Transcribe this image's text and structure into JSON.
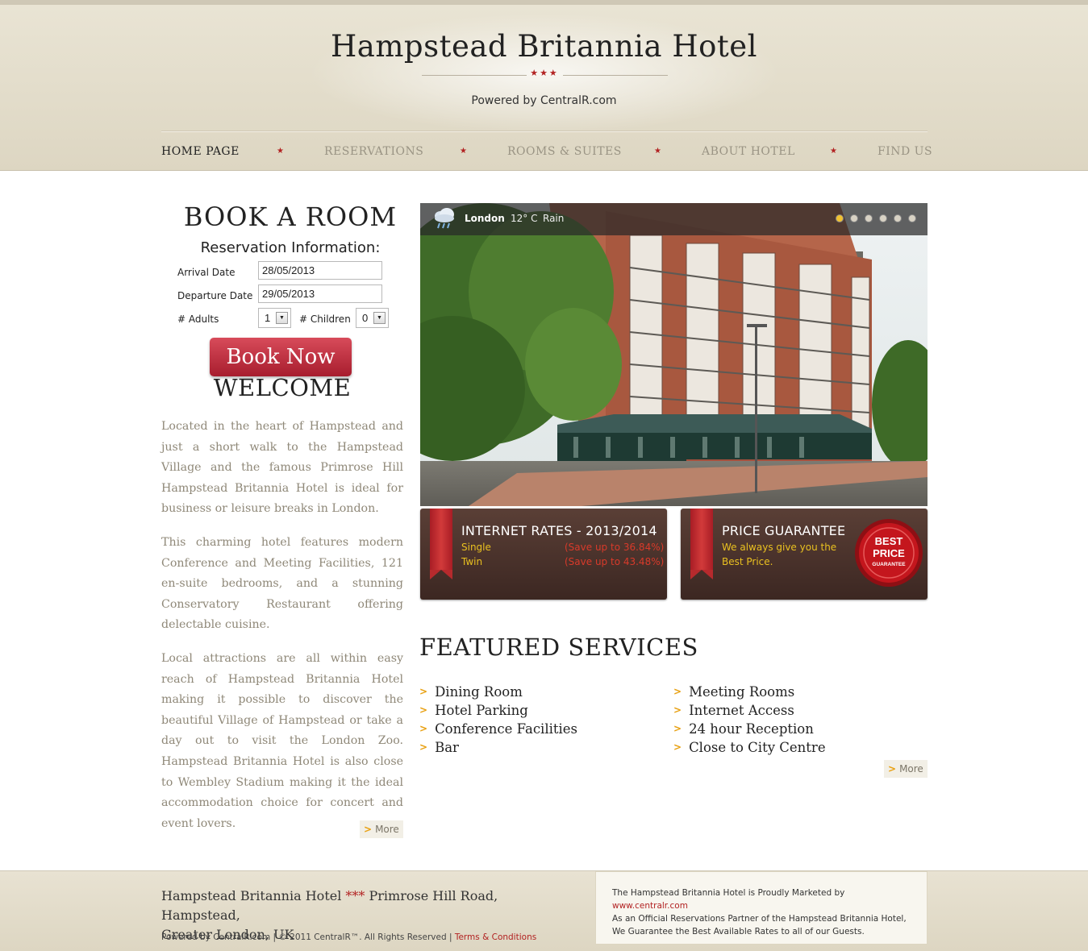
{
  "header": {
    "title": "Hampstead Britannia Hotel",
    "stars": "★★★",
    "powered_by": "Powered by CentralR.com"
  },
  "nav": {
    "items": [
      {
        "label": "HOME PAGE",
        "active": true
      },
      {
        "label": "RESERVATIONS",
        "active": false
      },
      {
        "label": "ROOMS & SUITES",
        "active": false
      },
      {
        "label": "ABOUT HOTEL",
        "active": false
      },
      {
        "label": "FIND US",
        "active": false
      }
    ],
    "separator": "★"
  },
  "booking": {
    "title": "BOOK A ROOM",
    "subtitle": "Reservation Information:",
    "arrival_label": "Arrival Date",
    "arrival_value": "28/05/2013",
    "departure_label": "Departure Date",
    "departure_value": "29/05/2013",
    "adults_label": "# Adults",
    "adults_value": "1",
    "children_label": "# Children",
    "children_value": "0",
    "button": "Book Now"
  },
  "welcome": {
    "title": "WELCOME",
    "paragraphs": [
      "Located in the heart of Hampstead and just a short walk to the Hampstead Village and the famous Primrose Hill Hampstead Britannia Hotel is ideal for business or leisure breaks in London.",
      "This charming hotel features modern Conference and Meeting Facilities, 121 en-suite bedrooms, and a stunning Conservatory Restaurant offering delectable cuisine.",
      "Local attractions are all within easy reach of Hampstead Britannia Hotel making it possible to discover the beautiful Village of Hampstead or take a day out to visit the London Zoo. Hampstead Britannia Hotel is also close to Wembley Stadium making it the ideal accommodation choice for concert and event lovers."
    ],
    "more": "More"
  },
  "weather": {
    "icon": "rain-cloud-icon",
    "city": "London",
    "temperature": "12° C",
    "condition": "Rain"
  },
  "slider": {
    "slide_count": 6,
    "active_index": 0
  },
  "promos": {
    "rates": {
      "title": "INTERNET RATES - 2013/2014",
      "rows": [
        {
          "room": "Single",
          "saving": "(Save up to 36.84%)"
        },
        {
          "room": "Twin",
          "saving": "(Save up to 43.48%)"
        }
      ]
    },
    "guarantee": {
      "title": "PRICE GUARANTEE",
      "line1": "We always give you the",
      "line2": "Best Price.",
      "seal_top": "BEST",
      "seal_mid": "PRICE",
      "seal_bottom": "GUARANTEE"
    }
  },
  "featured": {
    "title": "FEATURED SERVICES",
    "left": [
      "Dining Room",
      "Hotel Parking",
      "Conference Facilities",
      "Bar"
    ],
    "right": [
      "Meeting Rooms",
      "Internet Access",
      "24 hour Reception",
      "Close to City Centre"
    ],
    "more": "More"
  },
  "footer": {
    "hotel_name": "Hampstead Britannia Hotel",
    "stars": "***",
    "address_part1": "Primrose Hill Road, Hampstead,",
    "address_part2": "Greater London, UK",
    "copyright": "Powered by CentralR.com | © 2011 CentralR™. All Rights Reserved | ",
    "terms": "Terms & Conditions",
    "box_line1_prefix": "The Hampstead Britannia Hotel is Proudly Marketed by ",
    "box_link": "www.centralr.com",
    "box_line2": "As an Official Reservations Partner of the Hampstead Britannia Hotel,",
    "box_line3": "We Guarantee the Best Available Rates to all of our Guests."
  },
  "colors": {
    "accent_red": "#b22222",
    "button_red": "#c0303f",
    "header_bg": "#e2dccb",
    "promo_brown": "#4a322b",
    "bullet_orange": "#e8a010"
  }
}
